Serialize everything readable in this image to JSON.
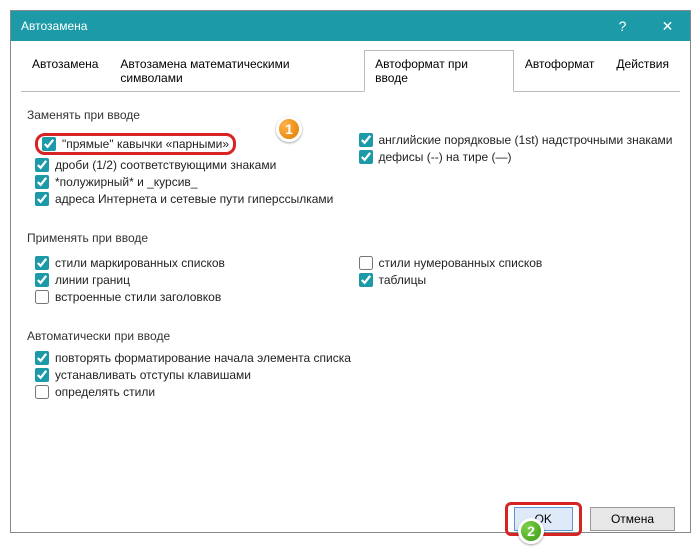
{
  "window": {
    "title": "Автозамена",
    "help_icon": "?",
    "close_icon": "✕"
  },
  "tabs": [
    "Автозамена",
    "Автозамена математическими символами",
    "Автоформат при вводе",
    "Автоформат",
    "Действия"
  ],
  "active_tab": 2,
  "group1": {
    "title": "Заменять при вводе",
    "left": [
      {
        "label": "\"прямые\" кавычки «парными»",
        "checked": true
      },
      {
        "label": "дроби (1/2) соответствующими знаками",
        "checked": true
      },
      {
        "label": "*полужирный* и _курсив_",
        "checked": true
      },
      {
        "label": "адреса Интернета и сетевые пути гиперссылками",
        "checked": true
      }
    ],
    "right": [
      {
        "label": "английские порядковые (1st) надстрочными знаками",
        "checked": true
      },
      {
        "label": "дефисы (--) на тире (—)",
        "checked": true
      }
    ]
  },
  "group2": {
    "title": "Применять при вводе",
    "left": [
      {
        "label": "стили маркированных списков",
        "checked": true
      },
      {
        "label": "линии границ",
        "checked": true
      },
      {
        "label": "встроенные стили заголовков",
        "checked": false
      }
    ],
    "right": [
      {
        "label": "стили нумерованных списков",
        "checked": false
      },
      {
        "label": "таблицы",
        "checked": true
      }
    ]
  },
  "group3": {
    "title": "Автоматически при вводе",
    "items": [
      {
        "label": "повторять форматирование начала элемента списка",
        "checked": true
      },
      {
        "label": "устанавливать отступы клавишами",
        "checked": true
      },
      {
        "label": "определять стили",
        "checked": false
      }
    ]
  },
  "buttons": {
    "ok": "OK",
    "cancel": "Отмена"
  },
  "callouts": {
    "c1": "1",
    "c2": "2"
  }
}
